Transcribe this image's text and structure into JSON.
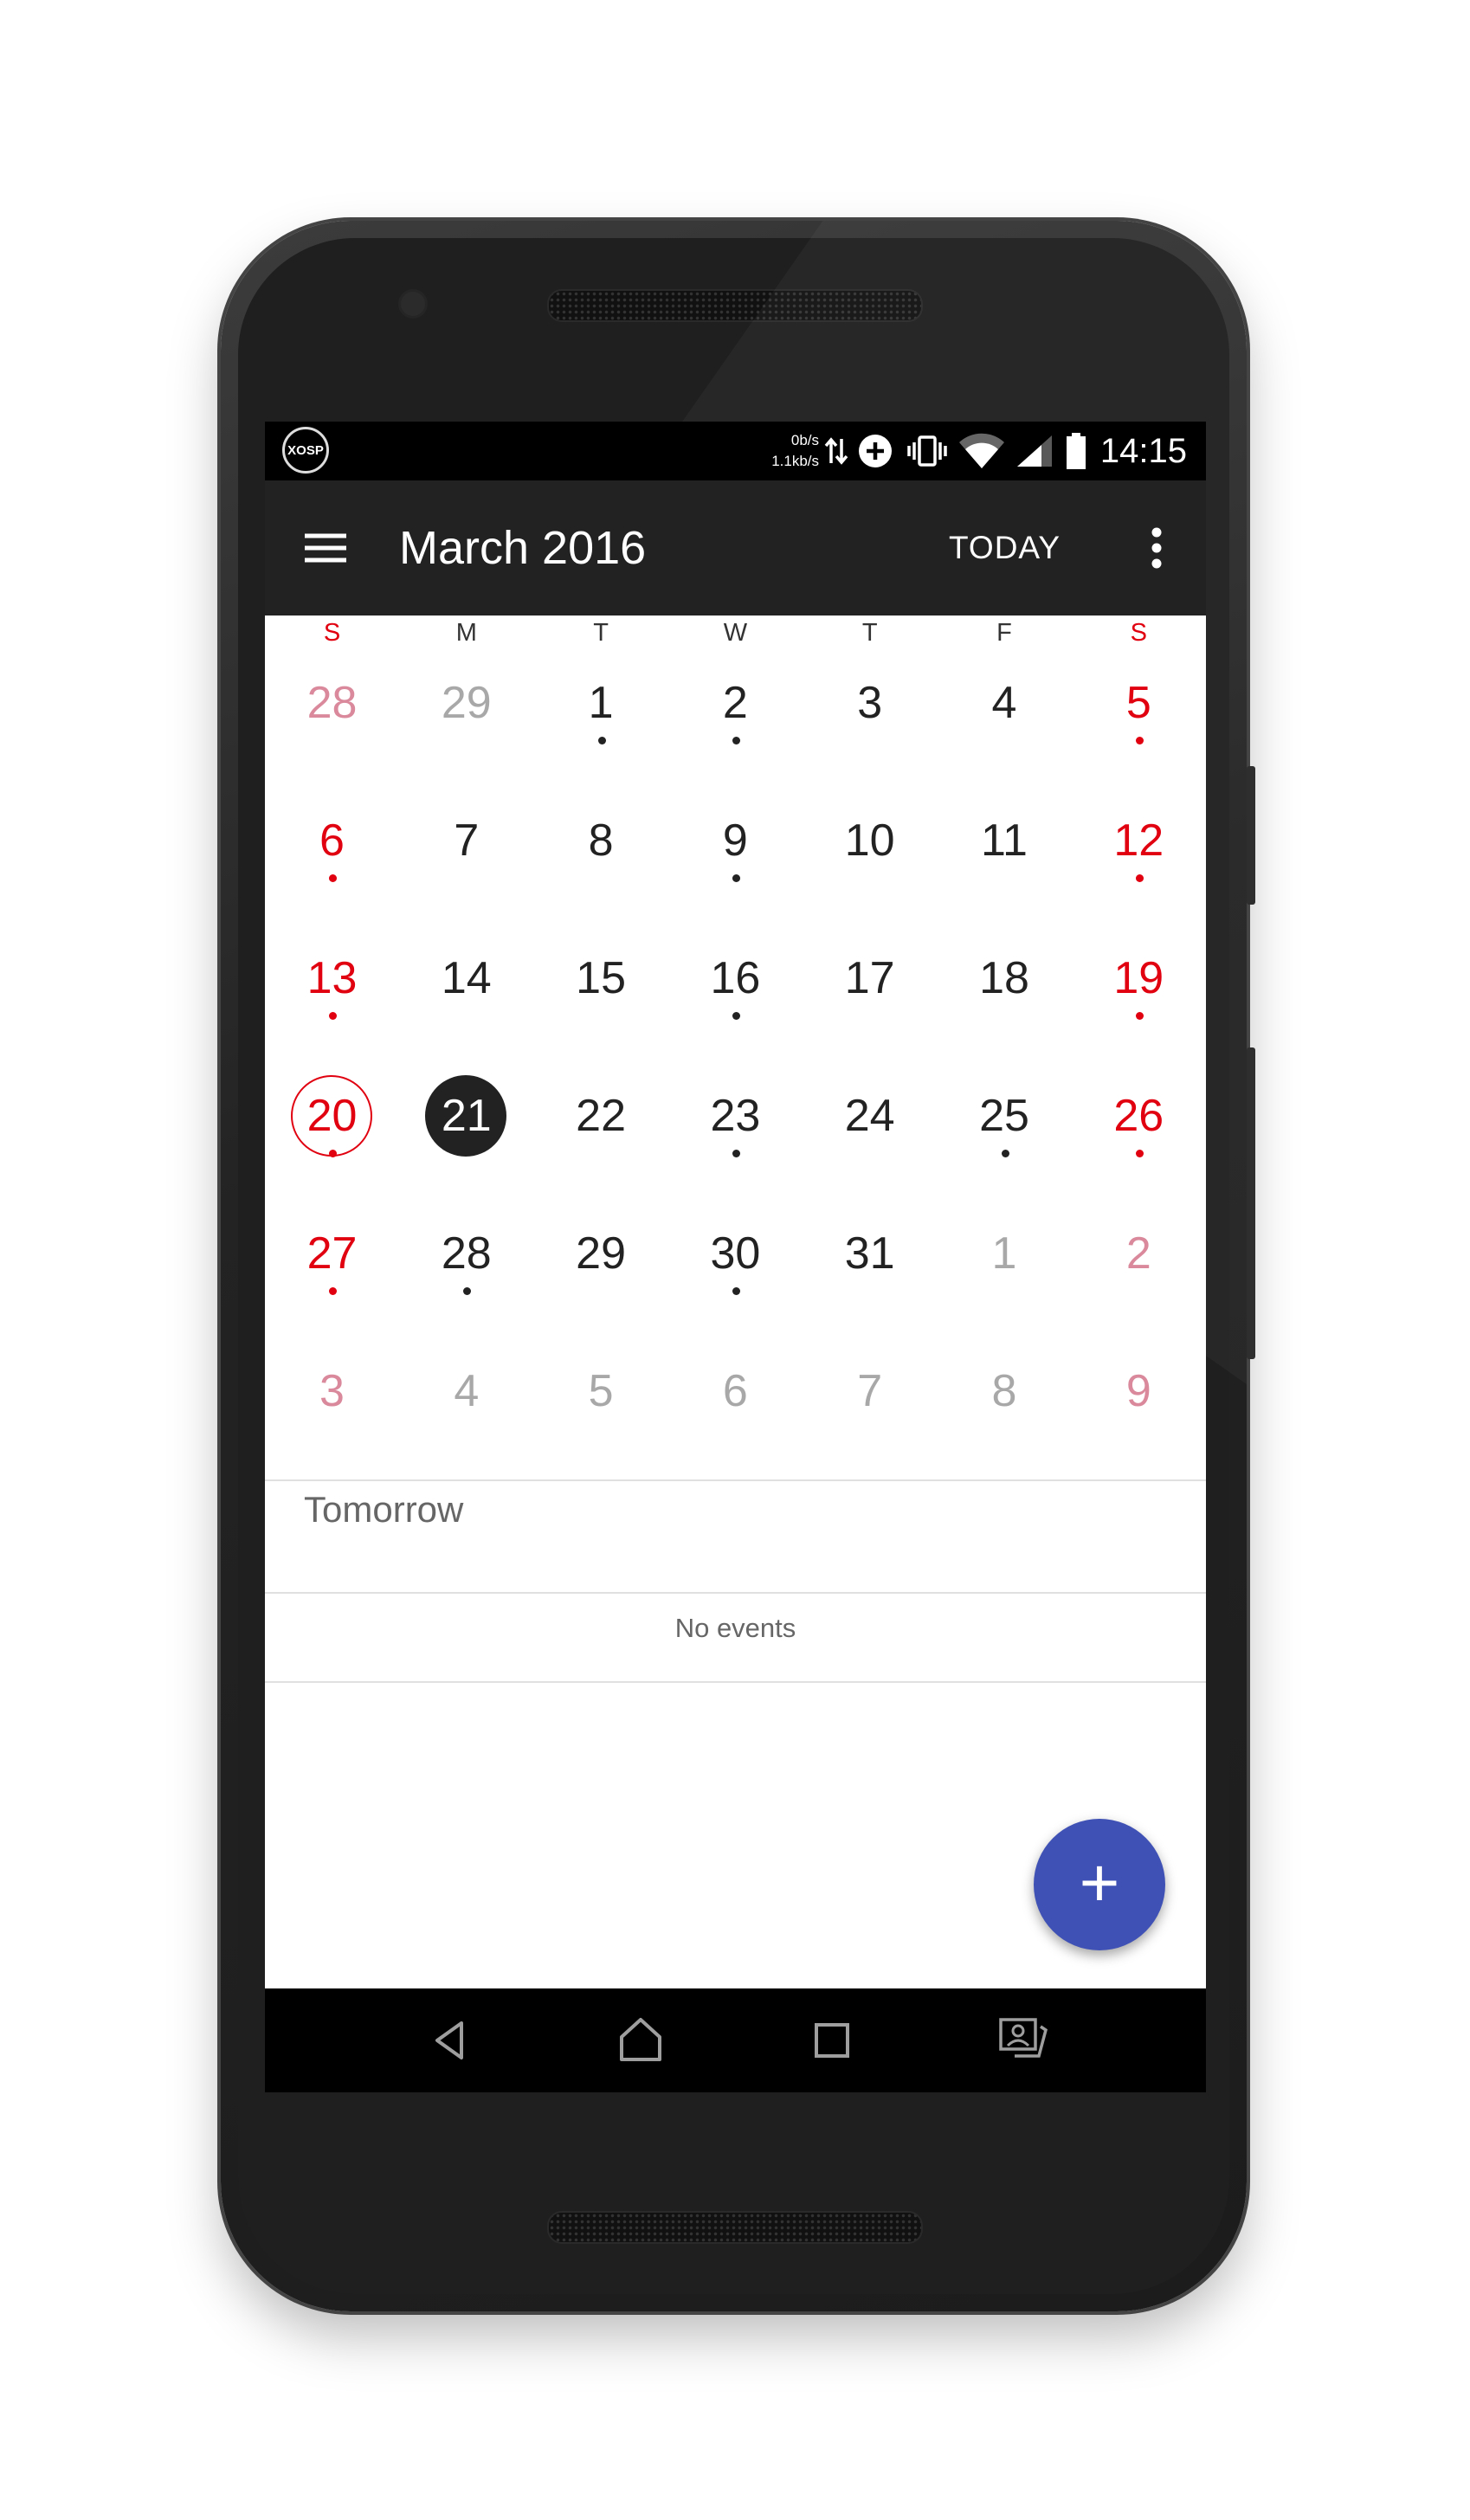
{
  "status_bar": {
    "carrier_badge": "XOSP",
    "net_speed_up": "0b/s",
    "net_speed_down": "1.1kb/s",
    "icons": [
      "data-transfer-icon",
      "add-circle-icon",
      "vibrate-icon",
      "wifi-icon",
      "signal-icon",
      "battery-icon"
    ],
    "time": "14:15"
  },
  "app_bar": {
    "menu_icon": "hamburger-menu-icon",
    "title": "March 2016",
    "today_label": "TODAY",
    "overflow_icon": "more-vert-icon",
    "background": "#222222"
  },
  "calendar": {
    "weekdays": [
      "S",
      "M",
      "T",
      "W",
      "T",
      "F",
      "S"
    ],
    "weekend_color": "#e0000f",
    "weekend_faded_color": "#d9899b",
    "other_month_color": "#a8a8a8",
    "text_color": "#222222",
    "selected_day": "21",
    "today_ring_day": "20",
    "weeks": [
      [
        {
          "d": "28",
          "other": true,
          "dot": false
        },
        {
          "d": "29",
          "other": true,
          "dot": false
        },
        {
          "d": "1",
          "other": false,
          "dot": true
        },
        {
          "d": "2",
          "other": false,
          "dot": true
        },
        {
          "d": "3",
          "other": false,
          "dot": false
        },
        {
          "d": "4",
          "other": false,
          "dot": false
        },
        {
          "d": "5",
          "other": false,
          "dot": true
        }
      ],
      [
        {
          "d": "6",
          "other": false,
          "dot": true
        },
        {
          "d": "7",
          "other": false,
          "dot": false
        },
        {
          "d": "8",
          "other": false,
          "dot": false
        },
        {
          "d": "9",
          "other": false,
          "dot": true
        },
        {
          "d": "10",
          "other": false,
          "dot": false
        },
        {
          "d": "11",
          "other": false,
          "dot": false
        },
        {
          "d": "12",
          "other": false,
          "dot": true
        }
      ],
      [
        {
          "d": "13",
          "other": false,
          "dot": true
        },
        {
          "d": "14",
          "other": false,
          "dot": false
        },
        {
          "d": "15",
          "other": false,
          "dot": false
        },
        {
          "d": "16",
          "other": false,
          "dot": true
        },
        {
          "d": "17",
          "other": false,
          "dot": false
        },
        {
          "d": "18",
          "other": false,
          "dot": false
        },
        {
          "d": "19",
          "other": false,
          "dot": true
        }
      ],
      [
        {
          "d": "20",
          "other": false,
          "dot": true
        },
        {
          "d": "21",
          "other": false,
          "dot": false
        },
        {
          "d": "22",
          "other": false,
          "dot": false
        },
        {
          "d": "23",
          "other": false,
          "dot": true
        },
        {
          "d": "24",
          "other": false,
          "dot": false
        },
        {
          "d": "25",
          "other": false,
          "dot": true
        },
        {
          "d": "26",
          "other": false,
          "dot": true
        }
      ],
      [
        {
          "d": "27",
          "other": false,
          "dot": true
        },
        {
          "d": "28",
          "other": false,
          "dot": true
        },
        {
          "d": "29",
          "other": false,
          "dot": false
        },
        {
          "d": "30",
          "other": false,
          "dot": true
        },
        {
          "d": "31",
          "other": false,
          "dot": false
        },
        {
          "d": "1",
          "other": true,
          "dot": false
        },
        {
          "d": "2",
          "other": true,
          "dot": false
        }
      ],
      [
        {
          "d": "3",
          "other": true,
          "dot": false
        },
        {
          "d": "4",
          "other": true,
          "dot": false
        },
        {
          "d": "5",
          "other": true,
          "dot": false
        },
        {
          "d": "6",
          "other": true,
          "dot": false
        },
        {
          "d": "7",
          "other": true,
          "dot": false
        },
        {
          "d": "8",
          "other": true,
          "dot": false
        },
        {
          "d": "9",
          "other": true,
          "dot": false
        }
      ]
    ]
  },
  "agenda": {
    "section_title": "Tomorrow",
    "empty_message": "No events"
  },
  "fab": {
    "icon": "add-icon",
    "symbol": "+",
    "color": "#3f51b5"
  },
  "nav_bar": {
    "icons": [
      "back-icon",
      "home-icon",
      "recents-icon",
      "multi-user-icon"
    ]
  }
}
